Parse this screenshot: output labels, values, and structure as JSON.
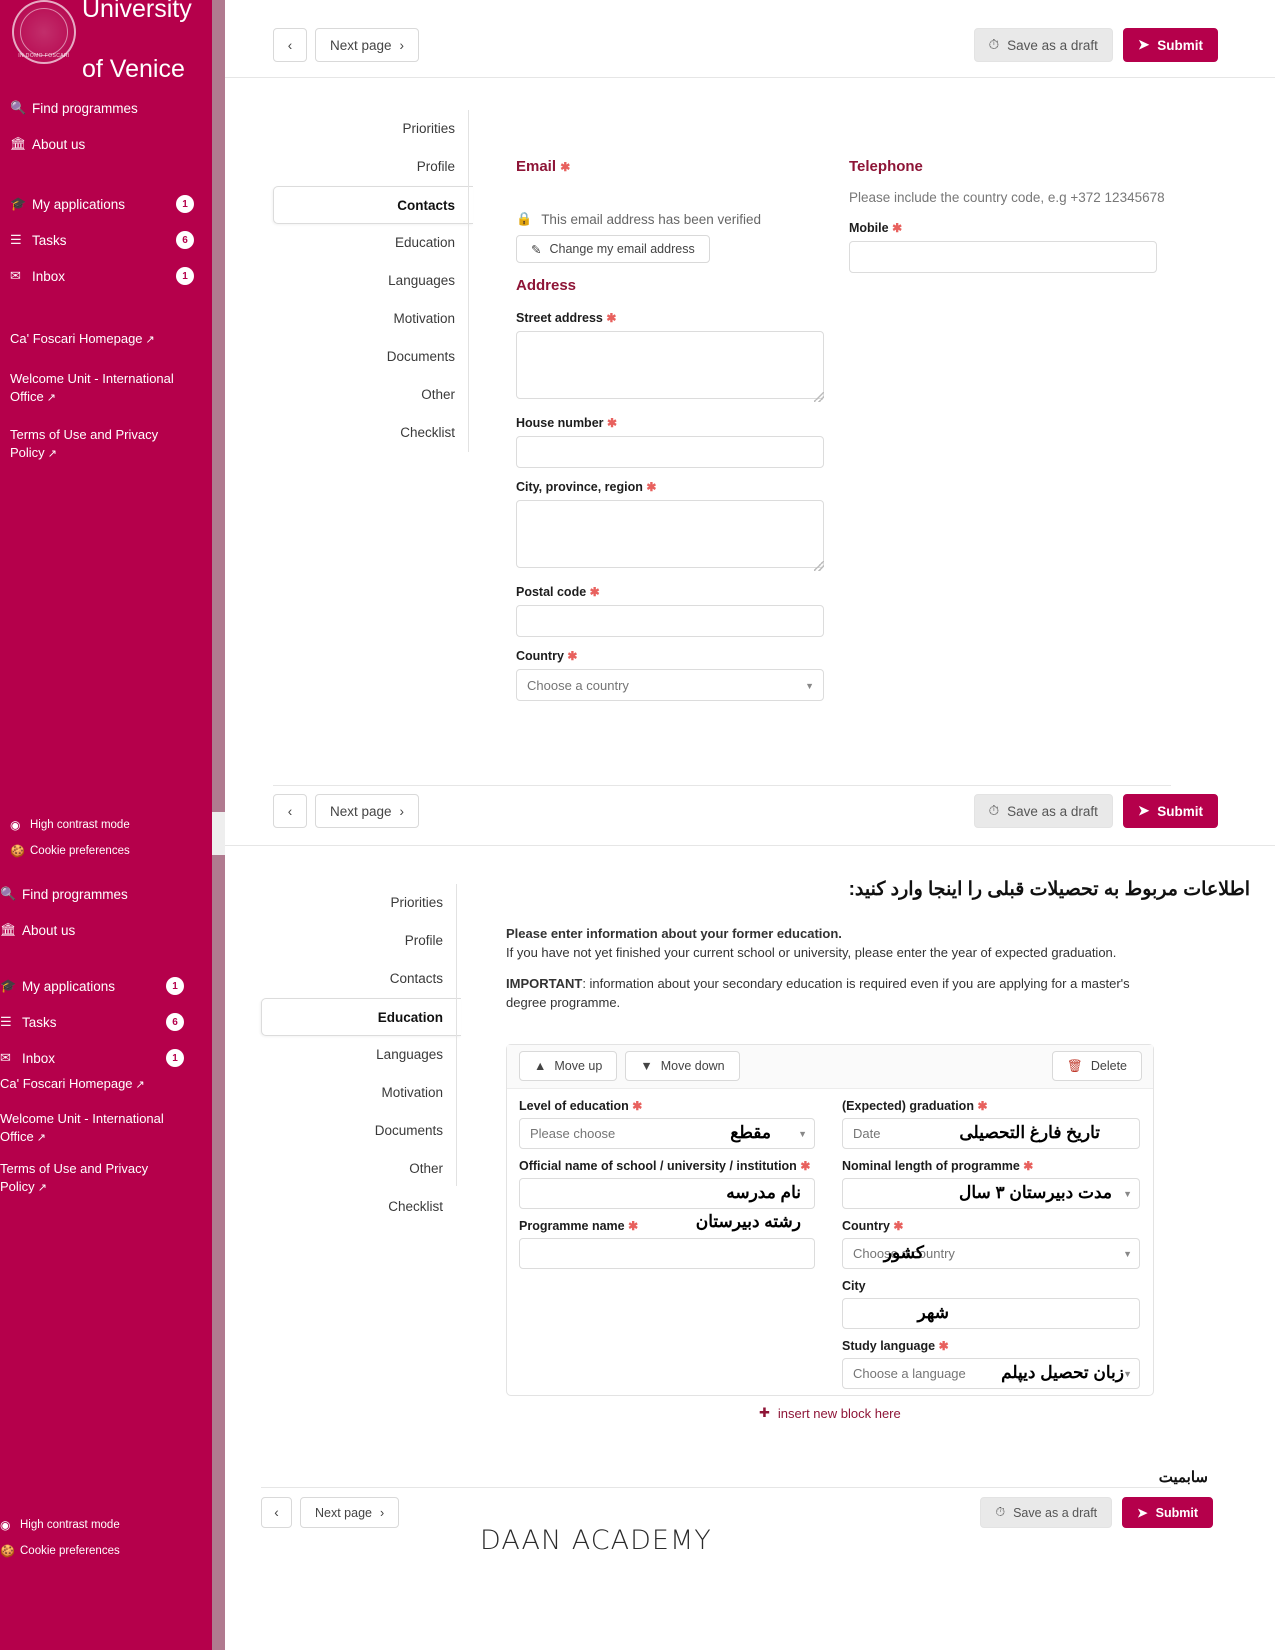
{
  "brand": {
    "name_line1": "University",
    "name_line2": "of Venice",
    "seal_text": "IN DOMO FOSCARI",
    "color": "#B5004B"
  },
  "sidebar": {
    "nav": [
      {
        "label": "Find programmes",
        "icon": "search-icon",
        "badge": ""
      },
      {
        "label": "About us",
        "icon": "bank-icon",
        "badge": ""
      },
      {
        "label": "My applications",
        "icon": "graduation-cap-icon",
        "badge": "1"
      },
      {
        "label": "Tasks",
        "icon": "list-icon",
        "badge": "6"
      },
      {
        "label": "Inbox",
        "icon": "inbox-icon",
        "badge": "1"
      }
    ],
    "links": [
      "Ca' Foscari Homepage",
      "Welcome Unit - International Office",
      "Terms of Use and Privacy Policy"
    ],
    "footer": [
      {
        "label": "High contrast mode",
        "icon": "contrast-icon"
      },
      {
        "label": "Cookie preferences",
        "icon": "cookie-icon"
      }
    ]
  },
  "toolbar": {
    "back_label": "‹",
    "next_label": "Next page",
    "next_chevron": "›",
    "draft_label": "Save as a draft",
    "submit_label": "Submit",
    "clock_icon": "clock-icon",
    "send_icon": "paper-plane-icon"
  },
  "steps": [
    "Priorities",
    "Profile",
    "Contacts",
    "Education",
    "Languages",
    "Motivation",
    "Documents",
    "Other",
    "Checklist"
  ],
  "contacts": {
    "active_step": "Contacts",
    "email": {
      "heading": "Email",
      "verified_text": "This email address has been verified",
      "change_button": "Change my email address",
      "lock_icon": "lock-icon",
      "pencil_icon": "pencil-icon"
    },
    "telephone": {
      "heading": "Telephone",
      "note": "Please include the country code, e.g +372 12345678",
      "mobile_label": "Mobile",
      "mobile_value": ""
    },
    "address": {
      "heading": "Address",
      "fields": [
        {
          "label": "Street address",
          "required": true,
          "type": "textarea",
          "value": ""
        },
        {
          "label": "House number",
          "required": true,
          "type": "text",
          "value": ""
        },
        {
          "label": "City, province, region",
          "required": true,
          "type": "textarea",
          "value": ""
        },
        {
          "label": "Postal code",
          "required": true,
          "type": "text",
          "value": ""
        },
        {
          "label": "Country",
          "required": true,
          "type": "select",
          "value": "",
          "placeholder": "Choose a country"
        }
      ]
    }
  },
  "education": {
    "active_step": "Education",
    "rtl_heading": "اطلاعات مربوط به تحصیلات قبلی را اینجا وارد کنید:",
    "intro_bold": "Please enter information about your former education.",
    "intro_line2": "If you have not yet finished your current school or university, please enter the year of expected graduation.",
    "important_label": "IMPORTANT",
    "important_text": ": information about your secondary education is required even if you are applying for a master's degree programme.",
    "block_controls": {
      "move_up": "Move up",
      "move_down": "Move down",
      "delete": "Delete",
      "up_icon": "chevron-up-icon",
      "down_icon": "chevron-down-icon",
      "trash_icon": "trash-icon"
    },
    "left_fields": [
      {
        "label": "Level of education",
        "required": true,
        "type": "select",
        "placeholder": "Please choose",
        "annotation": "مقطع"
      },
      {
        "label": "Official name of school / university / institution",
        "required": true,
        "type": "text",
        "placeholder": "",
        "annotation": "نام مدرسه"
      },
      {
        "label": "Programme name",
        "required": true,
        "type": "text",
        "placeholder": "",
        "annotation": "رشته دبیرستان"
      }
    ],
    "right_fields": [
      {
        "label": "(Expected) graduation",
        "required": true,
        "type": "text",
        "placeholder": "Date",
        "annotation": "تاریخ فارغ التحصیلی"
      },
      {
        "label": "Nominal length of programme",
        "required": true,
        "type": "select",
        "placeholder": "",
        "annotation": "مدت دبیرستان ۳ سال"
      },
      {
        "label": "Country",
        "required": true,
        "type": "select",
        "placeholder": "Choose a country",
        "annotation": "کشور"
      },
      {
        "label": "City",
        "required": false,
        "type": "text",
        "placeholder": "",
        "annotation": "شهر"
      },
      {
        "label": "Study language",
        "required": true,
        "type": "select",
        "placeholder": "Choose a language",
        "annotation": "زبان تحصیل دیپلم"
      }
    ],
    "insert_block": "insert new block here",
    "insert_icon": "plus-icon",
    "rtl_submit_note": "سابمیت"
  },
  "footer_brand": "DAAN ACADEMY"
}
